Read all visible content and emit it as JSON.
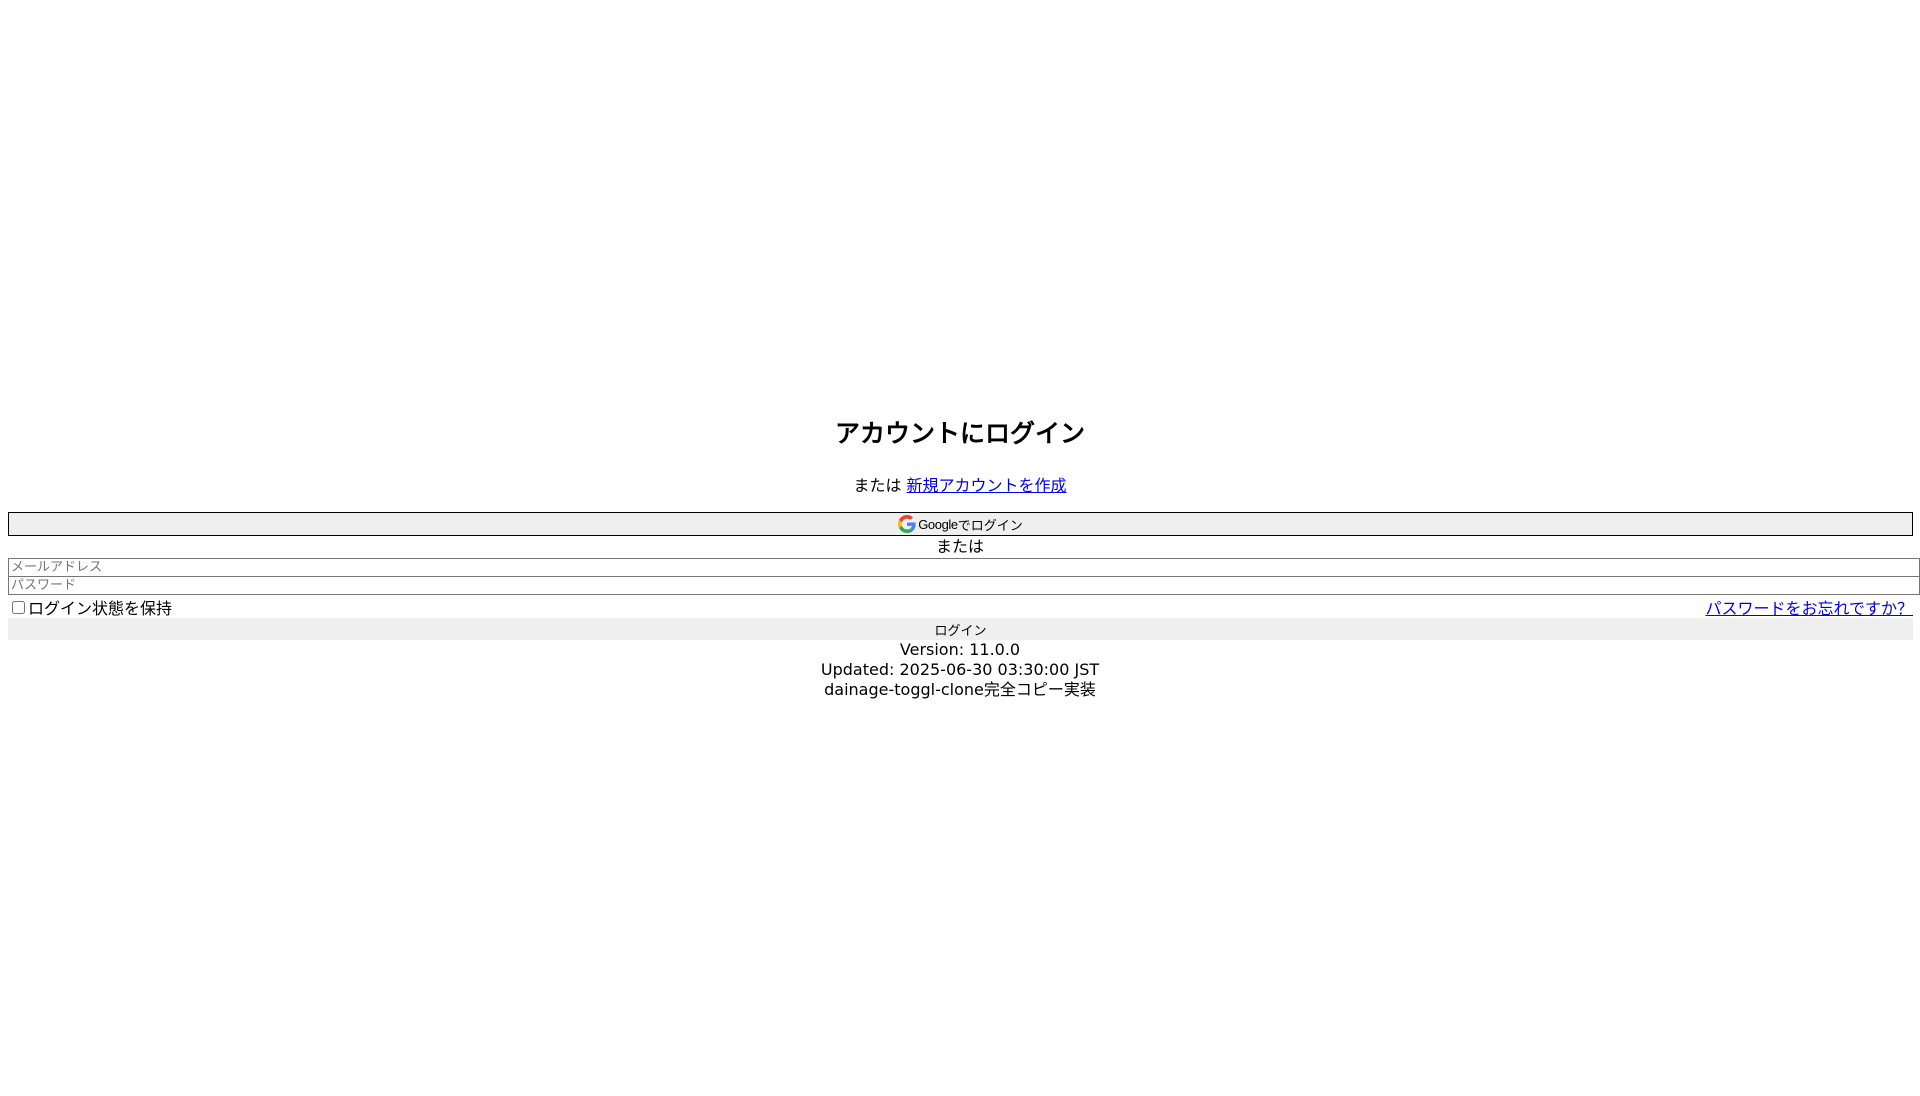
{
  "login": {
    "title": "アカウントにログイン",
    "subtitle_prefix": "または",
    "create_account_link": "新規アカウントを作成",
    "google_button_brand": "Google",
    "google_button_suffix": "でログイン",
    "divider": "または",
    "email_placeholder": "メールアドレス",
    "password_placeholder": "パスワード",
    "remember_label": "ログイン状態を保持",
    "forgot_password_link": "パスワードをお忘れですか？",
    "submit_label": "ログイン"
  },
  "footer": {
    "version": "Version: 11.0.0",
    "updated": "Updated: 2025-06-30 03:30:00 JST",
    "note": "dainage-toggl-clone完全コピー実装"
  },
  "icons": {
    "google": "google-g-icon"
  }
}
